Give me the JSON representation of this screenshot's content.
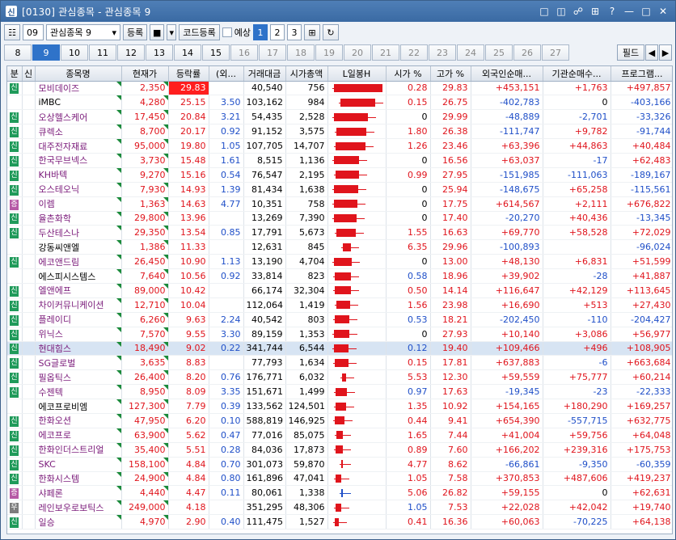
{
  "window": {
    "title": "[0130] 관심종목 - 관심종목 9",
    "app_icon": "신"
  },
  "toolbar": {
    "group_no": "09",
    "group_name": "관심종목 9",
    "register_label": "등록",
    "code_register_label": "코드등록",
    "expect_label": "예상",
    "pages": [
      "1",
      "2",
      "3"
    ],
    "active_page": "1"
  },
  "tabs": {
    "items": [
      "8",
      "9",
      "10",
      "11",
      "12",
      "13",
      "14",
      "15",
      "16",
      "17",
      "18",
      "19",
      "20",
      "21",
      "22",
      "23",
      "24",
      "25",
      "26",
      "27"
    ],
    "active": "9",
    "filter_label": "필드"
  },
  "columns": [
    "분",
    "신",
    "종목명",
    "현재가",
    "등락률",
    "(외...",
    "거래대금",
    "시가총액",
    "L일봉H",
    "시가 %",
    "고가 %",
    "외국인순매...",
    "기관순매수...",
    "프로그램..."
  ],
  "rows": [
    {
      "b": "신",
      "bt": "g",
      "name": "모비데이즈",
      "price": "2,350",
      "rate": "29.83",
      "ext": "",
      "vol": "40,540",
      "cap": "756",
      "cf": [
        0,
        0,
        1
      ],
      "open": "0.28",
      "high": "29.83",
      "foreign": "+453,151",
      "inst": "+1,763",
      "prog": "+497,857",
      "rc": "up",
      "hl": true,
      "oc": "up",
      "hc": "up",
      "fc": "up",
      "ic": "up",
      "pc": "up"
    },
    {
      "b": "",
      "bt": "",
      "name": "iMBC",
      "price": "4,280",
      "rate": "25.15",
      "ext": "3.50",
      "vol": "103,162",
      "cap": "984",
      "cf": [
        0.15,
        0.15,
        0.86
      ],
      "open": "0.15",
      "high": "26.75",
      "foreign": "-402,783",
      "inst": "0",
      "prog": "-403,166",
      "rc": "up",
      "oc": "up",
      "hc": "up",
      "fc": "down",
      "ic": "zero",
      "pc": "down"
    },
    {
      "b": "신",
      "bt": "g",
      "name": "오상헬스케어",
      "price": "17,450",
      "rate": "20.84",
      "ext": "3.21",
      "vol": "54,435",
      "cap": "2,528",
      "cf": [
        0,
        0,
        0.7
      ],
      "open": "0",
      "high": "29.99",
      "foreign": "-48,889",
      "inst": "-2,701",
      "prog": "-33,326",
      "rc": "up",
      "oc": "zero",
      "hc": "up",
      "fc": "down",
      "ic": "down",
      "pc": "down"
    },
    {
      "b": "신",
      "bt": "g",
      "name": "큐렉소",
      "price": "8,700",
      "rate": "20.17",
      "ext": "0.92",
      "vol": "91,152",
      "cap": "3,575",
      "cf": [
        0.05,
        0.06,
        0.67
      ],
      "open": "1.80",
      "high": "26.38",
      "foreign": "-111,747",
      "inst": "+9,782",
      "prog": "-91,744",
      "rc": "up",
      "oc": "up",
      "hc": "up",
      "fc": "down",
      "ic": "up",
      "pc": "down"
    },
    {
      "b": "신",
      "bt": "g",
      "name": "대주전자재료",
      "price": "95,000",
      "rate": "19.80",
      "ext": "1.05",
      "vol": "107,705",
      "cap": "14,707",
      "cf": [
        0.04,
        0.04,
        0.66
      ],
      "open": "1.26",
      "high": "23.46",
      "foreign": "+63,396",
      "inst": "+44,863",
      "prog": "+40,484",
      "rc": "up",
      "oc": "up",
      "hc": "up",
      "fc": "up",
      "ic": "up",
      "pc": "up"
    },
    {
      "b": "신",
      "bt": "g",
      "name": "한국무브넥스",
      "price": "3,730",
      "rate": "15.48",
      "ext": "1.61",
      "vol": "8,515",
      "cap": "1,136",
      "cf": [
        0,
        0,
        0.52
      ],
      "open": "0",
      "high": "16.56",
      "foreign": "+63,037",
      "inst": "-17",
      "prog": "+62,483",
      "rc": "up",
      "oc": "zero",
      "hc": "up",
      "fc": "up",
      "ic": "down",
      "pc": "up"
    },
    {
      "b": "신",
      "bt": "g",
      "name": "KH바텍",
      "price": "9,270",
      "rate": "15.16",
      "ext": "0.54",
      "vol": "76,547",
      "cap": "2,195",
      "cf": [
        0.03,
        0.03,
        0.51
      ],
      "open": "0.99",
      "high": "27.95",
      "foreign": "-151,985",
      "inst": "-111,063",
      "prog": "-189,167",
      "rc": "up",
      "oc": "up",
      "hc": "up",
      "fc": "down",
      "ic": "down",
      "pc": "down"
    },
    {
      "b": "신",
      "bt": "g",
      "name": "오스테오닉",
      "price": "7,930",
      "rate": "14.93",
      "ext": "1.39",
      "vol": "81,434",
      "cap": "1,638",
      "cf": [
        0,
        0,
        0.5
      ],
      "open": "0",
      "high": "25.94",
      "foreign": "-148,675",
      "inst": "+65,258",
      "prog": "-115,561",
      "rc": "up",
      "oc": "zero",
      "hc": "up",
      "fc": "down",
      "ic": "up",
      "pc": "down"
    },
    {
      "b": "증",
      "bt": "p",
      "name": "이렘",
      "price": "1,363",
      "rate": "14.63",
      "ext": "4.77",
      "vol": "10,351",
      "cap": "758",
      "cf": [
        0,
        0,
        0.49
      ],
      "open": "0",
      "high": "17.75",
      "foreign": "+614,567",
      "inst": "+2,111",
      "prog": "+676,822",
      "rc": "up",
      "oc": "zero",
      "hc": "up",
      "fc": "up",
      "ic": "up",
      "pc": "up"
    },
    {
      "b": "신",
      "bt": "g",
      "name": "율촌화학",
      "price": "29,800",
      "rate": "13.96",
      "ext": "",
      "vol": "13,269",
      "cap": "7,390",
      "cf": [
        0,
        0,
        0.47
      ],
      "open": "0",
      "high": "17.40",
      "foreign": "-20,270",
      "inst": "+40,436",
      "prog": "-13,345",
      "rc": "up",
      "oc": "zero",
      "hc": "up",
      "fc": "down",
      "ic": "up",
      "pc": "down"
    },
    {
      "b": "신",
      "bt": "g",
      "name": "두산테스나",
      "price": "29,350",
      "rate": "13.54",
      "ext": "0.85",
      "vol": "17,791",
      "cap": "5,673",
      "cf": [
        0.05,
        0.05,
        0.45
      ],
      "open": "1.55",
      "high": "16.63",
      "foreign": "+69,770",
      "inst": "+58,528",
      "prog": "+72,029",
      "rc": "up",
      "oc": "up",
      "hc": "up",
      "fc": "up",
      "ic": "up",
      "pc": "up"
    },
    {
      "b": "",
      "bt": "",
      "name": "강동씨앤엘",
      "price": "1,386",
      "rate": "11.33",
      "ext": "",
      "vol": "12,631",
      "cap": "845",
      "cf": [
        0.21,
        0.21,
        0.38
      ],
      "open": "6.35",
      "high": "29.96",
      "foreign": "-100,893",
      "inst": "",
      "prog": "-96,024",
      "rc": "up",
      "oc": "up",
      "hc": "up",
      "fc": "down",
      "ic": "zero",
      "pc": "down"
    },
    {
      "b": "신",
      "bt": "g",
      "name": "에코앤드림",
      "price": "26,450",
      "rate": "10.90",
      "ext": "1.13",
      "vol": "13,190",
      "cap": "4,704",
      "cf": [
        0,
        0,
        0.36
      ],
      "open": "0",
      "high": "13.00",
      "foreign": "+48,130",
      "inst": "+6,831",
      "prog": "+51,599",
      "rc": "up",
      "oc": "zero",
      "hc": "up",
      "fc": "up",
      "ic": "up",
      "pc": "up"
    },
    {
      "b": "",
      "bt": "",
      "name": "에스피시스템스",
      "price": "7,640",
      "rate": "10.56",
      "ext": "0.92",
      "vol": "33,814",
      "cap": "823",
      "cf": [
        0.02,
        0.02,
        0.35
      ],
      "open": "0.58",
      "high": "18.96",
      "foreign": "+39,902",
      "inst": "-28",
      "prog": "+41,887",
      "rc": "up",
      "oc": "down",
      "hc": "up",
      "fc": "up",
      "ic": "down",
      "pc": "up"
    },
    {
      "b": "신",
      "bt": "g",
      "name": "엘앤에프",
      "price": "89,000",
      "rate": "10.42",
      "ext": "",
      "vol": "66,174",
      "cap": "32,304",
      "cf": [
        0.02,
        0.02,
        0.35
      ],
      "open": "0.50",
      "high": "14.14",
      "foreign": "+116,647",
      "inst": "+42,129",
      "prog": "+113,645",
      "rc": "up",
      "oc": "up",
      "hc": "up",
      "fc": "up",
      "ic": "up",
      "pc": "up"
    },
    {
      "b": "신",
      "bt": "g",
      "name": "차이커뮤니케이션",
      "price": "12,710",
      "rate": "10.04",
      "ext": "",
      "vol": "112,064",
      "cap": "1,419",
      "cf": [
        0.05,
        0.05,
        0.33
      ],
      "open": "1.56",
      "high": "23.98",
      "foreign": "+16,690",
      "inst": "+513",
      "prog": "+27,430",
      "rc": "up",
      "oc": "up",
      "hc": "up",
      "fc": "up",
      "ic": "up",
      "pc": "up"
    },
    {
      "b": "신",
      "bt": "g",
      "name": "플레이디",
      "price": "6,260",
      "rate": "9.63",
      "ext": "2.24",
      "vol": "40,542",
      "cap": "803",
      "cf": [
        0.02,
        0.02,
        0.32
      ],
      "open": "0.53",
      "high": "18.21",
      "foreign": "-202,450",
      "inst": "-110",
      "prog": "-204,427",
      "rc": "up",
      "oc": "down",
      "hc": "up",
      "fc": "down",
      "ic": "down",
      "pc": "down"
    },
    {
      "b": "신",
      "bt": "g",
      "name": "위닉스",
      "price": "7,570",
      "rate": "9.55",
      "ext": "3.30",
      "vol": "89,159",
      "cap": "1,353",
      "cf": [
        0,
        0,
        0.32
      ],
      "open": "0",
      "high": "27.93",
      "foreign": "+10,140",
      "inst": "+3,086",
      "prog": "+56,977",
      "rc": "up",
      "oc": "zero",
      "hc": "up",
      "fc": "up",
      "ic": "up",
      "pc": "up"
    },
    {
      "b": "신",
      "bt": "g",
      "name": "현대힘스",
      "price": "18,490",
      "rate": "9.02",
      "ext": "0.22",
      "vol": "341,744",
      "cap": "6,544",
      "cf": [
        0,
        0,
        0.3
      ],
      "open": "0.12",
      "high": "19.40",
      "foreign": "+109,466",
      "inst": "+496",
      "prog": "+108,905",
      "rc": "up",
      "oc": "down",
      "hc": "up",
      "fc": "up",
      "ic": "up",
      "pc": "up",
      "sel": true
    },
    {
      "b": "신",
      "bt": "g",
      "name": "SG글로벌",
      "price": "3,635",
      "rate": "8.83",
      "ext": "",
      "vol": "77,793",
      "cap": "1,634",
      "cf": [
        0.01,
        0.01,
        0.29
      ],
      "open": "0.15",
      "high": "17.81",
      "foreign": "+637,883",
      "inst": "-6",
      "prog": "+663,684",
      "rc": "up",
      "oc": "up",
      "hc": "up",
      "fc": "up",
      "ic": "down",
      "pc": "up"
    },
    {
      "b": "신",
      "bt": "g",
      "name": "필옵틱스",
      "price": "26,400",
      "rate": "8.20",
      "ext": "0.76",
      "vol": "176,771",
      "cap": "6,032",
      "cf": [
        0.18,
        0.18,
        0.27
      ],
      "open": "5.53",
      "high": "12.30",
      "foreign": "+59,559",
      "inst": "+75,777",
      "prog": "+60,214",
      "rc": "up",
      "oc": "up",
      "hc": "up",
      "fc": "up",
      "ic": "up",
      "pc": "up"
    },
    {
      "b": "신",
      "bt": "g",
      "name": "수젠텍",
      "price": "8,950",
      "rate": "8.09",
      "ext": "3.35",
      "vol": "151,671",
      "cap": "1,499",
      "cf": [
        0.03,
        0.03,
        0.27
      ],
      "open": "0.97",
      "high": "17.63",
      "foreign": "-19,345",
      "inst": "-23",
      "prog": "-22,333",
      "rc": "up",
      "oc": "down",
      "hc": "up",
      "fc": "down",
      "ic": "down",
      "pc": "down"
    },
    {
      "b": "",
      "bt": "",
      "name": "에코프로비엠",
      "price": "127,300",
      "rate": "7.79",
      "ext": "0.39",
      "vol": "133,562",
      "cap": "124,501",
      "cf": [
        0.04,
        0.04,
        0.26
      ],
      "open": "1.35",
      "high": "10.92",
      "foreign": "+154,165",
      "inst": "+180,290",
      "prog": "+169,257",
      "rc": "up",
      "oc": "up",
      "hc": "up",
      "fc": "up",
      "ic": "up",
      "pc": "up"
    },
    {
      "b": "신",
      "bt": "g",
      "name": "한화오션",
      "price": "47,950",
      "rate": "6.20",
      "ext": "0.10",
      "vol": "588,819",
      "cap": "146,925",
      "cf": [
        0.01,
        0.01,
        0.21
      ],
      "open": "0.44",
      "high": "9.41",
      "foreign": "+654,390",
      "inst": "-557,715",
      "prog": "+632,775",
      "rc": "up",
      "oc": "up",
      "hc": "up",
      "fc": "up",
      "ic": "down",
      "pc": "up"
    },
    {
      "b": "신",
      "bt": "g",
      "name": "에코프로",
      "price": "63,900",
      "rate": "5.62",
      "ext": "0.47",
      "vol": "77,016",
      "cap": "85,075",
      "cf": [
        0.05,
        0.05,
        0.19
      ],
      "open": "1.65",
      "high": "7.44",
      "foreign": "+41,004",
      "inst": "+59,756",
      "prog": "+64,048",
      "rc": "up",
      "oc": "up",
      "hc": "up",
      "fc": "up",
      "ic": "up",
      "pc": "up"
    },
    {
      "b": "신",
      "bt": "g",
      "name": "한화인더스트리얼",
      "price": "35,400",
      "rate": "5.51",
      "ext": "0.28",
      "vol": "84,036",
      "cap": "17,873",
      "cf": [
        0.03,
        0.03,
        0.18
      ],
      "open": "0.89",
      "high": "7.60",
      "foreign": "+166,202",
      "inst": "+239,316",
      "prog": "+175,753",
      "rc": "up",
      "oc": "up",
      "hc": "up",
      "fc": "up",
      "ic": "up",
      "pc": "up"
    },
    {
      "b": "신",
      "bt": "g",
      "name": "SKC",
      "price": "158,100",
      "rate": "4.84",
      "ext": "0.70",
      "vol": "301,073",
      "cap": "59,870",
      "cf": [
        0.16,
        0.16,
        0.16
      ],
      "open": "4.77",
      "high": "8.62",
      "foreign": "-66,861",
      "inst": "-9,350",
      "prog": "-60,359",
      "rc": "up",
      "oc": "up",
      "hc": "up",
      "fc": "down",
      "ic": "down",
      "pc": "down"
    },
    {
      "b": "신",
      "bt": "g",
      "name": "한화시스템",
      "price": "24,900",
      "rate": "4.84",
      "ext": "0.80",
      "vol": "161,896",
      "cap": "47,041",
      "cf": [
        0.04,
        0.04,
        0.16
      ],
      "open": "1.05",
      "high": "7.58",
      "foreign": "+370,853",
      "inst": "+487,606",
      "prog": "+419,237",
      "rc": "up",
      "oc": "up",
      "hc": "up",
      "fc": "up",
      "ic": "up",
      "pc": "up"
    },
    {
      "b": "증",
      "bt": "p",
      "name": "샤페론",
      "price": "4,440",
      "rate": "4.47",
      "ext": "0.11",
      "vol": "80,061",
      "cap": "1,338",
      "cf": [
        0.17,
        0.17,
        0.15
      ],
      "open": "5.06",
      "high": "26.82",
      "foreign": "+59,155",
      "inst": "0",
      "prog": "+62,631",
      "rc": "up",
      "oc": "up",
      "hc": "up",
      "fc": "up",
      "ic": "zero",
      "pc": "up",
      "dn": true
    },
    {
      "b": "우",
      "bt": "gray",
      "name": "레인보우로보틱스",
      "price": "249,000",
      "rate": "4.18",
      "ext": "",
      "vol": "351,295",
      "cap": "48,306",
      "cf": [
        0.03,
        0.03,
        0.14
      ],
      "open": "1.05",
      "high": "7.53",
      "foreign": "+22,028",
      "inst": "+42,042",
      "prog": "+19,740",
      "rc": "up",
      "oc": "down",
      "hc": "up",
      "fc": "up",
      "ic": "up",
      "pc": "up"
    },
    {
      "b": "신",
      "bt": "g",
      "name": "일승",
      "price": "4,970",
      "rate": "2.90",
      "ext": "0.40",
      "vol": "111,475",
      "cap": "1,527",
      "cf": [
        0.01,
        0.01,
        0.1
      ],
      "open": "0.41",
      "high": "16.36",
      "foreign": "+60,063",
      "inst": "-70,225",
      "prog": "+64,138",
      "rc": "up",
      "oc": "up",
      "hc": "up",
      "fc": "up",
      "ic": "down",
      "pc": "up"
    }
  ],
  "colors": {
    "up": "#e0141c",
    "down": "#1f4fc8",
    "highlight": "#ff1e1e",
    "selected_row": "#d7e4f3",
    "title_bar": "#3a6aa3",
    "active_tab": "#2f73c9"
  },
  "icons": [
    "app-icon",
    "restore-icon",
    "popout-icon",
    "link-icon",
    "grid-icon",
    "help-icon",
    "minimize-icon",
    "maximize-icon",
    "close-icon"
  ]
}
